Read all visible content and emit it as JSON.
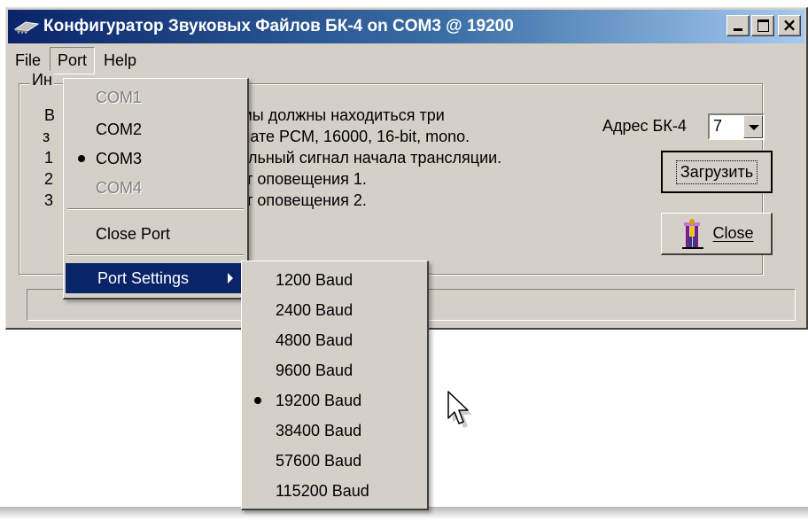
{
  "window": {
    "title": "Конфигуратор Звуковых Файлов БК-4  on COM3 @ 19200",
    "minimize_icon": "minimize-icon",
    "maximize_icon": "maximize-icon",
    "close_glyph": "×"
  },
  "menubar": {
    "items": [
      {
        "label": "File"
      },
      {
        "label": "Port"
      },
      {
        "label": "Help"
      }
    ]
  },
  "group": {
    "title_visible": "Ин",
    "left_fragments": [
      "В",
      "з",
      "1",
      "2",
      "3"
    ],
    "lines": [
      "ммы должны находиться три",
      "рмате PCM, 16000, 16-bit, mono.",
      "нальный сигнал начала трансляции.",
      "кст оповещения 1.",
      "кст оповещения 2."
    ]
  },
  "address": {
    "label": "Адрес БК-4",
    "value": "7"
  },
  "buttons": {
    "load": "Загрузить",
    "close": "Close"
  },
  "port_menu": {
    "items": [
      {
        "label": "COM1",
        "enabled": false,
        "checked": false
      },
      {
        "label": "COM2",
        "enabled": true,
        "checked": false
      },
      {
        "label": "COM3",
        "enabled": true,
        "checked": true
      },
      {
        "label": "COM4",
        "enabled": false,
        "checked": false
      }
    ],
    "close_port": "Close Port",
    "port_settings": "Port Settings"
  },
  "baud_menu": {
    "items": [
      {
        "label": "1200 Baud",
        "checked": false
      },
      {
        "label": "2400 Baud",
        "checked": false
      },
      {
        "label": "4800 Baud",
        "checked": false
      },
      {
        "label": "9600 Baud",
        "checked": false
      },
      {
        "label": "19200 Baud",
        "checked": true
      },
      {
        "label": "38400 Baud",
        "checked": false
      },
      {
        "label": "57600 Baud",
        "checked": false
      },
      {
        "label": "115200 Baud",
        "checked": false
      }
    ]
  },
  "colors": {
    "title_active": "#0a246a",
    "face": "#d4d0c8",
    "highlight": "#0a246a",
    "disabled_text": "#808080"
  }
}
